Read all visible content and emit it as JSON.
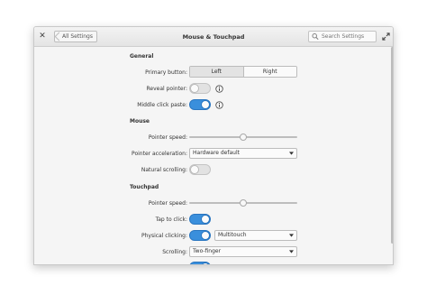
{
  "window": {
    "title": "Mouse & Touchpad",
    "back_label": "All Settings",
    "search_placeholder": "Search Settings"
  },
  "general": {
    "heading": "General",
    "primary_button_label": "Primary button:",
    "primary_options": [
      "Left",
      "Right"
    ],
    "primary_selected": "Left",
    "reveal_pointer_label": "Reveal pointer:",
    "reveal_pointer_on": false,
    "middle_click_label": "Middle click paste:",
    "middle_click_on": true
  },
  "mouse": {
    "heading": "Mouse",
    "pointer_speed_label": "Pointer speed:",
    "pointer_speed_value": 0.5,
    "acceleration_label": "Pointer acceleration:",
    "acceleration_value": "Hardware default",
    "natural_scrolling_label": "Natural scrolling:",
    "natural_scrolling_on": false
  },
  "touchpad": {
    "heading": "Touchpad",
    "pointer_speed_label": "Pointer speed:",
    "pointer_speed_value": 0.5,
    "tap_to_click_label": "Tap to click:",
    "tap_to_click_on": true,
    "physical_clicking_label": "Physical clicking:",
    "physical_clicking_on": true,
    "physical_clicking_mode": "Multitouch",
    "scrolling_label": "Scrolling:",
    "scrolling_value": "Two-finger"
  },
  "colors": {
    "accent": "#3a8fdc",
    "window_bg": "#f5f5f5"
  }
}
